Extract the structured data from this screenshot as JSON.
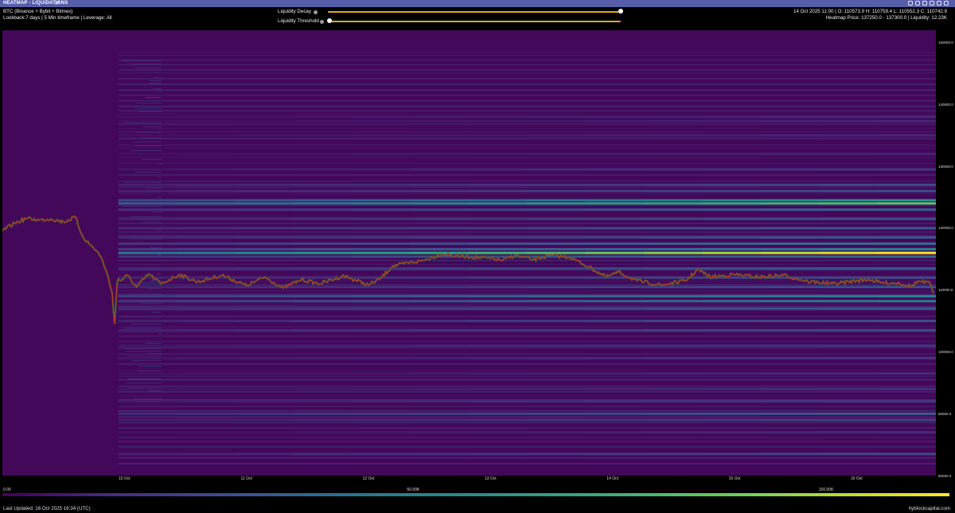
{
  "window": {
    "title": "HEATMAP - LIQUIDATIONS",
    "title_icon": "swap-arrows-icon",
    "header_icons": [
      "minimize-icon",
      "restore-icon",
      "settings-icon",
      "screenshot-icon",
      "fullscreen-icon",
      "close-icon"
    ]
  },
  "info": {
    "symbol": "BTC (Binance + Bybit + Bitmex)",
    "params": "Lookback:7 days | 5 Min timeframe | Leverage: All",
    "ohlc": "14 Oct 2025 11:00 | O: 110573.9 H: 110759.4 L: 110552.3 C: 110742.9",
    "hover": "Heatmap Price: 137250.0 - 137300.0 | Liquidity: 12.23K"
  },
  "controls": {
    "decay_label": "Liquidity Decay",
    "threshold_label": "Liquidity Threshold",
    "decay_value": 1.0,
    "threshold_value": 0.0,
    "slider_color": "#d9a732"
  },
  "chart_data": {
    "type": "heatmap",
    "y_ticks": [
      "150000.0",
      "140000.0",
      "130000.0",
      "120000.0",
      "110000.0",
      "100000.0",
      "90000.0",
      "80000.0"
    ],
    "x_ticks": [
      "10 Oct",
      "11 Oct",
      "12 Oct",
      "13 Oct",
      "14 Oct",
      "15 Oct",
      "16 Oct"
    ],
    "ylim": [
      80000,
      152000
    ],
    "colorbar": {
      "labels": [
        "0.00",
        "50.00K",
        "100.00K"
      ],
      "range": [
        0,
        115000
      ],
      "colormap": "viridis"
    },
    "price_series": {
      "name": "BTC",
      "days": [
        9.0,
        9.1,
        9.2,
        9.3,
        9.4,
        9.5,
        9.6,
        9.62,
        9.66,
        9.72,
        9.78,
        9.82,
        9.86,
        9.9,
        9.92,
        9.94,
        9.95,
        9.97,
        10.02,
        10.1,
        10.2,
        10.3,
        10.45,
        10.6,
        10.8,
        11.0,
        11.15,
        11.3,
        11.45,
        11.6,
        11.8,
        12.0,
        12.1,
        12.2,
        12.45,
        12.6,
        12.8,
        13.0,
        13.1,
        13.2,
        13.35,
        13.5,
        13.65,
        13.8,
        13.95,
        14.05,
        14.2,
        14.4,
        14.6,
        14.7,
        14.8,
        15.0,
        15.2,
        15.4,
        15.6,
        15.8,
        16.0,
        16.1,
        16.2,
        16.35,
        16.45,
        16.5,
        16.6,
        16.63
      ],
      "prices": [
        119600,
        120800,
        121600,
        121300,
        121500,
        121000,
        121800,
        120500,
        118600,
        117300,
        116200,
        114800,
        112500,
        109500,
        104500,
        111000,
        111800,
        111500,
        112400,
        110500,
        112600,
        111000,
        112500,
        111300,
        112400,
        110700,
        112100,
        110300,
        111700,
        111000,
        112300,
        110800,
        111900,
        113900,
        114800,
        115800,
        115400,
        115100,
        114800,
        115600,
        114900,
        115600,
        115300,
        113800,
        112100,
        112900,
        111500,
        110800,
        111500,
        113300,
        112100,
        112500,
        112100,
        112400,
        111400,
        111000,
        111500,
        111700,
        111200,
        111100,
        110600,
        111400,
        111100,
        109500
      ]
    },
    "x_range_days": [
      9.0,
      16.65
    ],
    "liquidity_start_day": 9.95,
    "levels": [
      {
        "price": 138000,
        "value": 14000
      },
      {
        "price": 137300,
        "value": 12230
      },
      {
        "price": 135000,
        "value": 13000
      },
      {
        "price": 132000,
        "value": 12000
      },
      {
        "price": 129500,
        "value": 18000
      },
      {
        "price": 127000,
        "value": 26000
      },
      {
        "price": 126000,
        "value": 28000
      },
      {
        "price": 124500,
        "value": 62000
      },
      {
        "price": 124000,
        "value": 85000
      },
      {
        "price": 123000,
        "value": 35000
      },
      {
        "price": 121500,
        "value": 28000
      },
      {
        "price": 120000,
        "value": 33000
      },
      {
        "price": 118500,
        "value": 32000
      },
      {
        "price": 117500,
        "value": 45000
      },
      {
        "price": 116600,
        "value": 52000
      },
      {
        "price": 116000,
        "value": 115000
      },
      {
        "price": 115400,
        "value": 40000
      },
      {
        "price": 113500,
        "value": 32000
      },
      {
        "price": 112000,
        "value": 28000
      },
      {
        "price": 110500,
        "value": 30000
      },
      {
        "price": 109000,
        "value": 52000
      },
      {
        "price": 108200,
        "value": 48000
      },
      {
        "price": 107000,
        "value": 34000
      },
      {
        "price": 105000,
        "value": 28000
      },
      {
        "price": 103500,
        "value": 27000
      },
      {
        "price": 101000,
        "value": 18000
      },
      {
        "price": 99000,
        "value": 18000
      },
      {
        "price": 96500,
        "value": 14000
      },
      {
        "price": 94000,
        "value": 16000
      },
      {
        "price": 92000,
        "value": 20000
      },
      {
        "price": 90000,
        "value": 36000
      },
      {
        "price": 89000,
        "value": 24000
      },
      {
        "price": 87000,
        "value": 14000
      },
      {
        "price": 83500,
        "value": 26000
      }
    ]
  },
  "footer": {
    "updated": "Last Updated: 16 Oct 2025 16:34 (UTC)",
    "brand": "hyblockcapital.com"
  }
}
